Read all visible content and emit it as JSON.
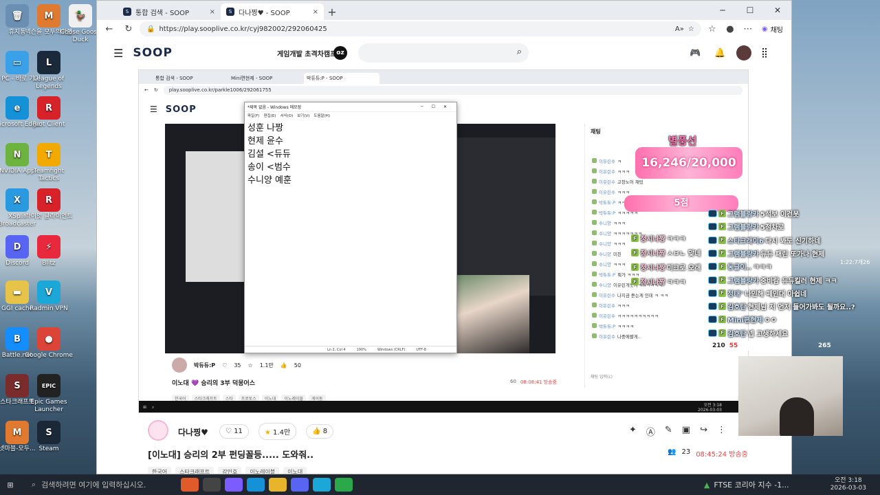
{
  "desktop": {
    "icons": [
      {
        "label": "휴지통",
        "color": "#6a8fb2",
        "glyph": "🗑"
      },
      {
        "label": "넥슨을 모두의마블",
        "color": "#e07a30",
        "glyph": "M"
      },
      {
        "label": "Goose Goose Duck",
        "color": "#f0f0f0",
        "glyph": "🦆"
      },
      {
        "label": "내 PC - 바로 가기",
        "color": "#3aa0e8",
        "glyph": "▭"
      },
      {
        "label": "League of Legends",
        "color": "#1b2a3a",
        "glyph": "L"
      },
      {
        "label": "Microsoft Edge",
        "color": "#1591d8",
        "glyph": "e"
      },
      {
        "label": "Riot Client",
        "color": "#d8222a",
        "glyph": "R"
      },
      {
        "label": "NVIDIA App",
        "color": "#6cb33f",
        "glyph": "N"
      },
      {
        "label": "Teamfight Tactics",
        "color": "#f2a900",
        "glyph": "T"
      },
      {
        "label": "XSplit Broadcaster",
        "color": "#2a9ae0",
        "glyph": "X"
      },
      {
        "label": "라이엇 클라이언트",
        "color": "#d8222a",
        "glyph": "R"
      },
      {
        "label": "Discord",
        "color": "#5865f2",
        "glyph": "D"
      },
      {
        "label": "Blitz",
        "color": "#e8283c",
        "glyph": "⚡"
      },
      {
        "label": "GGI cache",
        "color": "#e8c34a",
        "glyph": "▬"
      },
      {
        "label": "Radmin VPN",
        "color": "#1ba8d8",
        "glyph": "V"
      },
      {
        "label": "Battle.net",
        "color": "#148eff",
        "glyph": "B"
      },
      {
        "label": "Google Chrome",
        "color": "#db4437",
        "glyph": "●"
      },
      {
        "label": "스타크래프트",
        "color": "#7a2c2c",
        "glyph": "S"
      },
      {
        "label": "Epic Games Launcher",
        "color": "#222",
        "glyph": "EPIC"
      },
      {
        "label": "넷마블-모두...",
        "color": "#e07a30",
        "glyph": "M"
      },
      {
        "label": "Steam",
        "color": "#1b2838",
        "glyph": "S"
      }
    ]
  },
  "browser": {
    "tabs": [
      {
        "label": "통합 검색 - SOOP"
      },
      {
        "label": "다나찡♥ - SOOP"
      }
    ],
    "url": "https://play.sooplive.co.kr/cyj982002/292060425",
    "chat_button": "채팅"
  },
  "soop": {
    "logo": "SOOP",
    "banner": "게임개발 초격차캠프",
    "banner_badge": "oz"
  },
  "inner": {
    "tabs": [
      "통합 검색 - SOOP",
      "Mini편현제 - SOOP",
      "박듀듀:P - SOOP"
    ],
    "url": "play.sooplive.co.kr/parkle1006/292061755",
    "notepad": {
      "title": "*제목 없음 - Windows 메모장",
      "menu": [
        "파일(F)",
        "편집(E)",
        "서식(O)",
        "보기(V)",
        "도움말(H)"
      ],
      "lines": [
        "성훈 나짱",
        "현제 윤수",
        "김설 <듀듀",
        "송이 <범수",
        "수니양 예훈"
      ],
      "status": [
        "Ln 2, Col 4",
        "190%",
        "Windows (CRLF)",
        "UTF-8"
      ]
    },
    "streamer": "박듀듀:P",
    "likes": "35",
    "fav": "1.1만",
    "up": "50",
    "stream_title": "이노대 💜 승리의 3부 덕몽어스",
    "viewers": "60",
    "duration": "08:08:41 방송중",
    "tags": [
      "한국어",
      "스타크래프트",
      "스타",
      "프로토스",
      "이노대",
      "이노레이블",
      "게이동"
    ],
    "chat_title": "채팅",
    "chat_input": "채팅 입력(c)",
    "chat": [
      {
        "nick": "이유린수",
        "msg": "ㅋ"
      },
      {
        "nick": "이유린수",
        "msg": "ㅋㅋㅋ"
      },
      {
        "nick": "이유린수",
        "msg": "고창노어 재밌"
      },
      {
        "nick": "이유린수",
        "msg": "ㅋㅋㅋ"
      },
      {
        "nick": "박듀듀:P",
        "msg": "ㅋㅋㅋㅋㅋㅋㅋㅋㅋ"
      },
      {
        "nick": "박듀듀:P",
        "msg": "ㅋㅋㅋㅋㅋ"
      },
      {
        "nick": "수니양",
        "msg": "ㅋㅋㅋ"
      },
      {
        "nick": "수니양",
        "msg": "ㅋㅋㅋㅋㅋㅋㅋ"
      },
      {
        "nick": "수니양",
        "msg": "ㅋㅋㅋ"
      },
      {
        "nick": "수니양",
        "msg": "미친"
      },
      {
        "nick": "수니양",
        "msg": "ㅋㅋㅋ"
      },
      {
        "nick": "박듀듀:P",
        "msg": "뭐가 ㅋㅋㅋ"
      },
      {
        "nick": "수니양",
        "msg": "이유린개웃겨ㅋㅋㅋㅋㅋㅋ"
      },
      {
        "nick": "이유린수",
        "msg": "나지금 듣는게 인데 ㅋ ㅋㅋ"
      },
      {
        "nick": "이유린수",
        "msg": "ㅋㅋㅋ"
      },
      {
        "nick": "이유린수",
        "msg": "ㅋㅋㅋㅋㅋㅋㅋㅋㅋㅋ"
      },
      {
        "nick": "박듀듀:P",
        "msg": "ㅋㅋㅋㅋ"
      },
      {
        "nick": "이유린수",
        "msg": "나중에봘게.."
      }
    ],
    "taskbar_time": "오전 3:18",
    "taskbar_date": "2026-03-03"
  },
  "overlay": {
    "top_label": "별풍선",
    "goal": "16,246/20,000",
    "points": "5점",
    "chat": [
      {
        "nick": "그램블랑카",
        "msg": "5석보 이건못"
      },
      {
        "nick": "그램블랑카",
        "msg": "5점차로"
      },
      {
        "nick": "스타크래이6",
        "msg": "다시 봐도 신기하네"
      },
      {
        "nick": "그램블랑카",
        "msg": "듀듀 패린 또가나 현제"
      },
      {
        "nick": "동글이..",
        "msg": "ㅋㅋㅋ"
      },
      {
        "nick": "그램블랑카",
        "msg": "중바람 듀듀킬러 현제 ㅋㅋ"
      },
      {
        "nick": "정태°",
        "msg": "나인해 떼인대 아쉽네"
      },
      {
        "nick": "김호탄",
        "msg": "현제님 저 먼저 들어가봐도 될까요..?"
      },
      {
        "nick": "Mini편현제",
        "msg": "ㅇㅇ"
      },
      {
        "nick": "김호탄",
        "msg": "넵 고생하세요"
      }
    ],
    "left_chat": [
      {
        "nick": "정시나짱",
        "msg": "ㅋㅋㅋ"
      },
      {
        "nick": "정시나짱",
        "msg": "ㅅㅂㄴ 맞네"
      },
      {
        "nick": "정시나짱",
        "msg": "미크로 오래"
      },
      {
        "nick": "정시나짱",
        "msg": "ㅋㅋㅋ"
      }
    ],
    "stat1": "210",
    "stat2": "55",
    "stat3": "265",
    "side_time": "1:22:7개26"
  },
  "main": {
    "streamer": "다나찡♥",
    "likes": "11",
    "fav": "1.4만",
    "up": "8",
    "title": "[이노대] 승리의 2부 펀딩꼴등..... 도와줘..",
    "viewers": "23",
    "duration": "08:45:24 방송중",
    "tags": [
      "한국어",
      "스타크래프트",
      "강인호",
      "이노레이블",
      "이노대"
    ]
  },
  "taskbar": {
    "search": "검색하려면 여기에 입력하십시오.",
    "ticker": "FTSE 코리아 지수 -1...",
    "time": "오전 3:18",
    "date": "2026-03-03"
  }
}
